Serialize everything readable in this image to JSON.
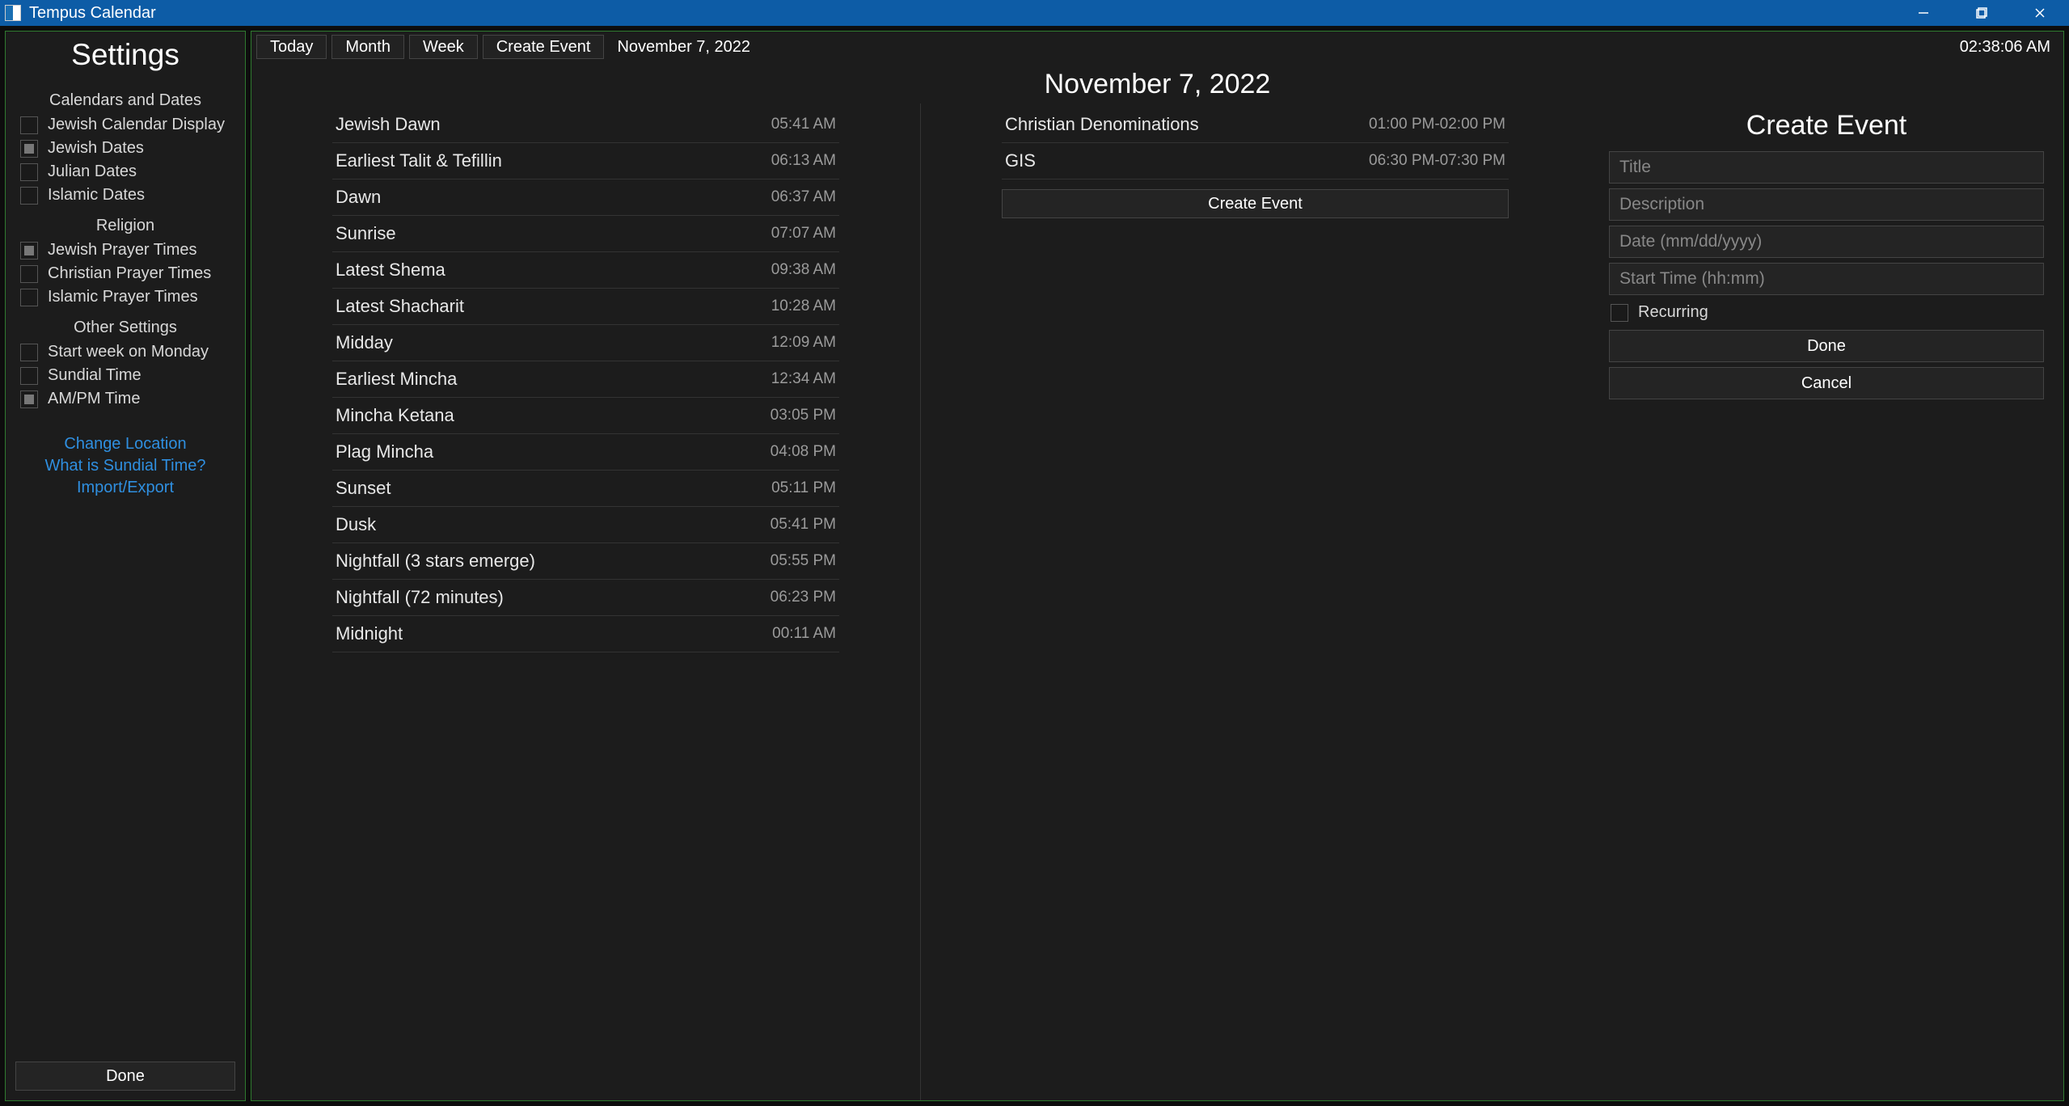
{
  "titlebar": {
    "app_name": "Tempus Calendar"
  },
  "sidebar": {
    "title": "Settings",
    "sections": {
      "calendars": {
        "heading": "Calendars and Dates",
        "items": [
          {
            "label": "Jewish Calendar Display",
            "checked": false
          },
          {
            "label": "Jewish Dates",
            "checked": true
          },
          {
            "label": "Julian Dates",
            "checked": false
          },
          {
            "label": "Islamic Dates",
            "checked": false
          }
        ]
      },
      "religion": {
        "heading": "Religion",
        "items": [
          {
            "label": "Jewish Prayer Times",
            "checked": true
          },
          {
            "label": "Christian Prayer Times",
            "checked": false
          },
          {
            "label": "Islamic Prayer Times",
            "checked": false
          }
        ]
      },
      "other": {
        "heading": "Other Settings",
        "items": [
          {
            "label": "Start week on Monday",
            "checked": false
          },
          {
            "label": "Sundial Time",
            "checked": false
          },
          {
            "label": "AM/PM Time",
            "checked": true
          }
        ]
      }
    },
    "links": {
      "change_location": "Change Location",
      "sundial_info": "What is Sundial Time?",
      "import_export": "Import/Export"
    },
    "done_label": "Done"
  },
  "toolbar": {
    "today": "Today",
    "month": "Month",
    "week": "Week",
    "create_event": "Create Event",
    "current_date": "November 7, 2022",
    "clock": "02:38:06 AM"
  },
  "main": {
    "date_title": "November 7, 2022",
    "prayer_times": [
      {
        "label": "Jewish Dawn",
        "time": "05:41 AM"
      },
      {
        "label": "Earliest Talit & Tefillin",
        "time": "06:13 AM"
      },
      {
        "label": "Dawn",
        "time": "06:37 AM"
      },
      {
        "label": "Sunrise",
        "time": "07:07 AM"
      },
      {
        "label": "Latest Shema",
        "time": "09:38 AM"
      },
      {
        "label": "Latest Shacharit",
        "time": "10:28 AM"
      },
      {
        "label": "Midday",
        "time": "12:09 AM"
      },
      {
        "label": "Earliest Mincha",
        "time": "12:34 AM"
      },
      {
        "label": "Mincha Ketana",
        "time": "03:05 PM"
      },
      {
        "label": "Plag Mincha",
        "time": "04:08 PM"
      },
      {
        "label": "Sunset",
        "time": "05:11 PM"
      },
      {
        "label": "Dusk",
        "time": "05:41 PM"
      },
      {
        "label": "Nightfall (3 stars emerge)",
        "time": "05:55 PM"
      },
      {
        "label": "Nightfall (72 minutes)",
        "time": "06:23 PM"
      },
      {
        "label": "Midnight",
        "time": "00:11 AM"
      }
    ],
    "events": [
      {
        "label": "Christian Denominations",
        "time": "01:00 PM-02:00 PM"
      },
      {
        "label": "GIS",
        "time": "06:30 PM-07:30 PM"
      }
    ],
    "create_event_label": "Create Event"
  },
  "create_panel": {
    "title": "Create Event",
    "placeholders": {
      "title": "Title",
      "description": "Description",
      "date": "Date (mm/dd/yyyy)",
      "start_time": "Start Time (hh:mm)"
    },
    "recurring_label": "Recurring",
    "done_label": "Done",
    "cancel_label": "Cancel"
  }
}
